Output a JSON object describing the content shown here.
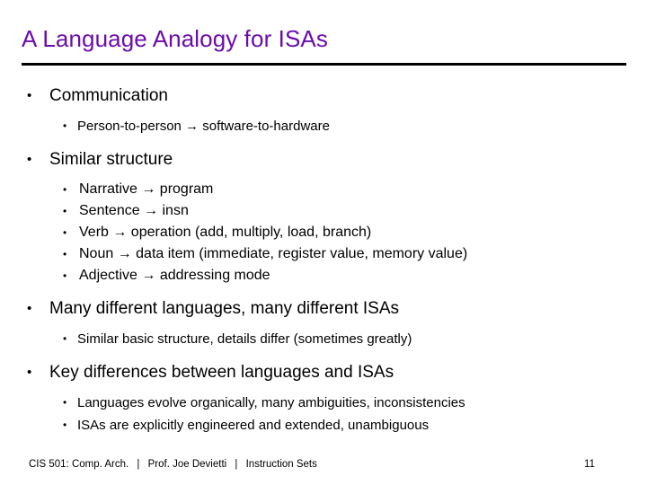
{
  "slide": {
    "title": "A Language Analogy for ISAs",
    "title_color": "#6a0dad",
    "rule_color": "#000000",
    "background_color": "#ffffff",
    "bullet_glyph": "•",
    "arrow_glyph": "→"
  },
  "content": [
    {
      "level": 1,
      "text": "Communication"
    },
    {
      "level": 2,
      "text": "Person-to-person → software-to-hardware"
    },
    {
      "level": 1,
      "text": "Similar structure"
    },
    {
      "level": 3,
      "text": "Narrative → program"
    },
    {
      "level": 3,
      "text": "Sentence → insn"
    },
    {
      "level": 3,
      "text": "Verb → operation (add, multiply, load, branch)"
    },
    {
      "level": 3,
      "text": "Noun → data item (immediate, register value, memory value)"
    },
    {
      "level": 3,
      "text": "Adjective → addressing mode"
    },
    {
      "level": 1,
      "text": "Many different languages, many different ISAs"
    },
    {
      "level": 2,
      "text": "Similar basic structure, details differ (sometimes greatly)"
    },
    {
      "level": 1,
      "text": "Key differences between languages and ISAs"
    },
    {
      "level": 2,
      "text": "Languages evolve organically, many ambiguities, inconsistencies"
    },
    {
      "level": 2,
      "text": "ISAs are explicitly engineered and extended, unambiguous"
    }
  ],
  "footer": {
    "course": "CIS 501: Comp. Arch.",
    "separator_1": "|",
    "instructor": "Prof. Joe Devietti",
    "separator_2": "|",
    "topic": "Instruction Sets",
    "page_number": "11"
  }
}
